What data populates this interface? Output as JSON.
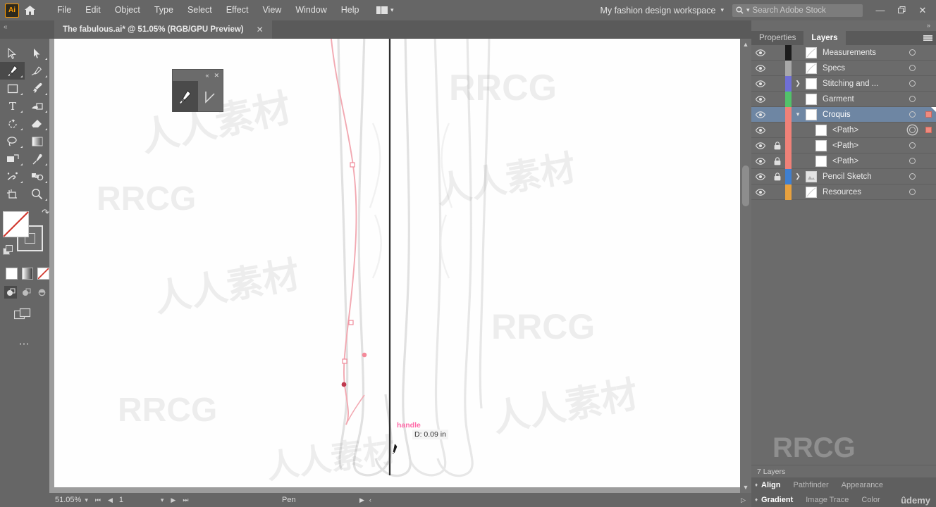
{
  "app": {
    "name": "Adobe Illustrator",
    "logo_text": "Ai",
    "home_icon": "home-icon"
  },
  "menubar": {
    "items": [
      "File",
      "Edit",
      "Object",
      "Type",
      "Select",
      "Effect",
      "View",
      "Window",
      "Help"
    ],
    "arrange_documents_icon": "arrange-documents-icon",
    "workspace_label": "My fashion design workspace",
    "workspace_chevron": "chevron-down-icon",
    "search": {
      "icon": "search-icon",
      "placeholder": "Search Adobe Stock",
      "value": ""
    },
    "window_buttons": {
      "minimize": "—",
      "restore": "❐",
      "close": "✕"
    }
  },
  "tabbar": {
    "collapse_icon": "collapse-panel-icon",
    "document_title": "The fabulous.ai* @ 51.05% (RGB/GPU Preview)",
    "close_icon": "✕",
    "expand_icon": "expand-panels-icon"
  },
  "toolbar": {
    "tools": [
      {
        "name": "selection-tool",
        "label": "Selection",
        "selected": false,
        "has_flyout": false
      },
      {
        "name": "direct-selection-tool",
        "label": "Direct Selection",
        "selected": false,
        "has_flyout": true
      },
      {
        "name": "pen-tool",
        "label": "Pen",
        "selected": true,
        "has_flyout": true
      },
      {
        "name": "curvature-tool",
        "label": "Curvature",
        "selected": false,
        "has_flyout": true
      },
      {
        "name": "rectangle-tool",
        "label": "Rectangle",
        "selected": false,
        "has_flyout": true
      },
      {
        "name": "paintbrush-tool",
        "label": "Paintbrush",
        "selected": false,
        "has_flyout": true
      },
      {
        "name": "type-tool",
        "label": "Type",
        "selected": false,
        "has_flyout": true
      },
      {
        "name": "shape-builder-tool",
        "label": "Shape Builder",
        "selected": false,
        "has_flyout": true
      },
      {
        "name": "rotate-tool",
        "label": "Rotate",
        "selected": false,
        "has_flyout": true
      },
      {
        "name": "eraser-tool",
        "label": "Eraser",
        "selected": false,
        "has_flyout": true
      },
      {
        "name": "lasso-tool",
        "label": "Lasso",
        "selected": false,
        "has_flyout": true
      },
      {
        "name": "gradient-tool",
        "label": "Gradient",
        "selected": false,
        "has_flyout": false
      },
      {
        "name": "free-transform-tool",
        "label": "Free Transform",
        "selected": false,
        "has_flyout": true
      },
      {
        "name": "eyedropper-tool",
        "label": "Eyedropper",
        "selected": false,
        "has_flyout": true
      },
      {
        "name": "symbol-sprayer-tool",
        "label": "Symbol Sprayer",
        "selected": false,
        "has_flyout": true
      },
      {
        "name": "column-graph-tool",
        "label": "Column Graph",
        "selected": false,
        "has_flyout": true
      },
      {
        "name": "artboard-tool",
        "label": "Artboard",
        "selected": false,
        "has_flyout": false
      },
      {
        "name": "zoom-tool",
        "label": "Zoom",
        "selected": false,
        "has_flyout": true
      }
    ],
    "fill_color": "#ffffff",
    "fill_is_none": true,
    "stroke_color": "#6f6f6f",
    "swap_icon": "swap-fill-stroke-icon",
    "default_icon": "default-fill-stroke-icon",
    "color_modes": [
      "color-mode",
      "gradient-mode",
      "none-mode"
    ],
    "draw_modes": [
      "draw-normal",
      "draw-behind",
      "draw-inside"
    ],
    "screen_mode_icon": "change-screen-mode-icon",
    "edit_toolbar_icon": "edit-toolbar-icon"
  },
  "canvas": {
    "floating_toolbar": {
      "collapse_icon": "«",
      "close_icon": "✕",
      "tools": [
        {
          "name": "pen-tool",
          "label": "Pen",
          "selected": true
        },
        {
          "name": "anchor-point-tool",
          "label": "Anchor Point",
          "selected": false
        }
      ]
    },
    "annotations": {
      "handle_label": "handle",
      "handle_color": "#ff6aa8",
      "distance_label": "D: 0.09 in"
    },
    "cursor": "pen-tool-cursor",
    "path_stroke_color": "#f4a6ae",
    "center_guide_color": "#2e2e2e"
  },
  "right_panel": {
    "expand_icon": "expand-icon",
    "tabs": [
      {
        "label": "Properties",
        "active": false
      },
      {
        "label": "Layers",
        "active": true
      }
    ],
    "menu_icon": "panel-menu-icon",
    "layers": [
      {
        "name": "Measurements",
        "color": "#1c1c1c",
        "visible": true,
        "locked": false,
        "expandable": false,
        "expanded": false,
        "indent": 0,
        "selected": false,
        "targeted": false,
        "has_selection": false,
        "thumb": "shape"
      },
      {
        "name": "Specs",
        "color": "#a8a8a8",
        "visible": true,
        "locked": false,
        "expandable": false,
        "expanded": false,
        "indent": 0,
        "selected": false,
        "targeted": false,
        "has_selection": false,
        "thumb": "shape"
      },
      {
        "name": "Stitching and ...",
        "color": "#6f6fd6",
        "visible": true,
        "locked": false,
        "expandable": true,
        "expanded": false,
        "indent": 0,
        "selected": false,
        "targeted": false,
        "has_selection": false,
        "thumb": "blank"
      },
      {
        "name": "Garment",
        "color": "#52c26a",
        "visible": true,
        "locked": false,
        "expandable": false,
        "expanded": false,
        "indent": 0,
        "selected": false,
        "targeted": false,
        "has_selection": false,
        "thumb": "blank"
      },
      {
        "name": "Croquis",
        "color": "#ef8178",
        "visible": true,
        "locked": false,
        "expandable": true,
        "expanded": true,
        "indent": 0,
        "selected": true,
        "targeted": false,
        "has_selection": true,
        "thumb": "blank"
      },
      {
        "name": "<Path>",
        "color": "#ef8178",
        "visible": true,
        "locked": false,
        "expandable": false,
        "expanded": false,
        "indent": 1,
        "selected": false,
        "targeted": true,
        "has_selection": true,
        "thumb": "blank"
      },
      {
        "name": "<Path>",
        "color": "#ef8178",
        "visible": true,
        "locked": true,
        "expandable": false,
        "expanded": false,
        "indent": 1,
        "selected": false,
        "targeted": false,
        "has_selection": false,
        "thumb": "blank"
      },
      {
        "name": "<Path>",
        "color": "#ef8178",
        "visible": true,
        "locked": true,
        "expandable": false,
        "expanded": false,
        "indent": 1,
        "selected": false,
        "targeted": false,
        "has_selection": false,
        "thumb": "blank"
      },
      {
        "name": "Pencil Sketch",
        "color": "#3f7fd0",
        "visible": true,
        "locked": true,
        "expandable": true,
        "expanded": false,
        "indent": 0,
        "selected": false,
        "targeted": false,
        "has_selection": false,
        "thumb": "image"
      },
      {
        "name": "Resources",
        "color": "#e8a13e",
        "visible": true,
        "locked": false,
        "expandable": false,
        "expanded": false,
        "indent": 0,
        "selected": false,
        "targeted": false,
        "has_selection": false,
        "thumb": "shape"
      }
    ],
    "layer_count": "7 Layers",
    "dock": {
      "row1": [
        "Align",
        "Pathfinder",
        "Appearance"
      ],
      "row2": [
        "Gradient",
        "Image Trace",
        "Color"
      ]
    },
    "branding": "ûdemy"
  },
  "statusbar": {
    "zoom_level": "51.05%",
    "zoom_chevron": "chevron-down-icon",
    "first_page_icon": "first-page-icon",
    "prev_page_icon": "prev-page-icon",
    "page_value": "1",
    "page_chevron": "chevron-down-icon",
    "next_page_icon": "next-page-icon",
    "last_page_icon": "last-page-icon",
    "current_tool": "Pen",
    "nav_forward_icon": "▶",
    "nav_back_icon": "‹"
  },
  "watermarks": {
    "text_cn": "人人素材",
    "text_en": "RRCG"
  },
  "colors": {
    "menubar_bg": "#666666",
    "panel_bg": "#6b6b6b",
    "canvas_bg": "#9c9c9c",
    "artboard_bg": "#fefefe",
    "row_selected": "#6e86a3",
    "accent_orange": "#ff9a00",
    "selection_salmon": "#f08a7e"
  }
}
